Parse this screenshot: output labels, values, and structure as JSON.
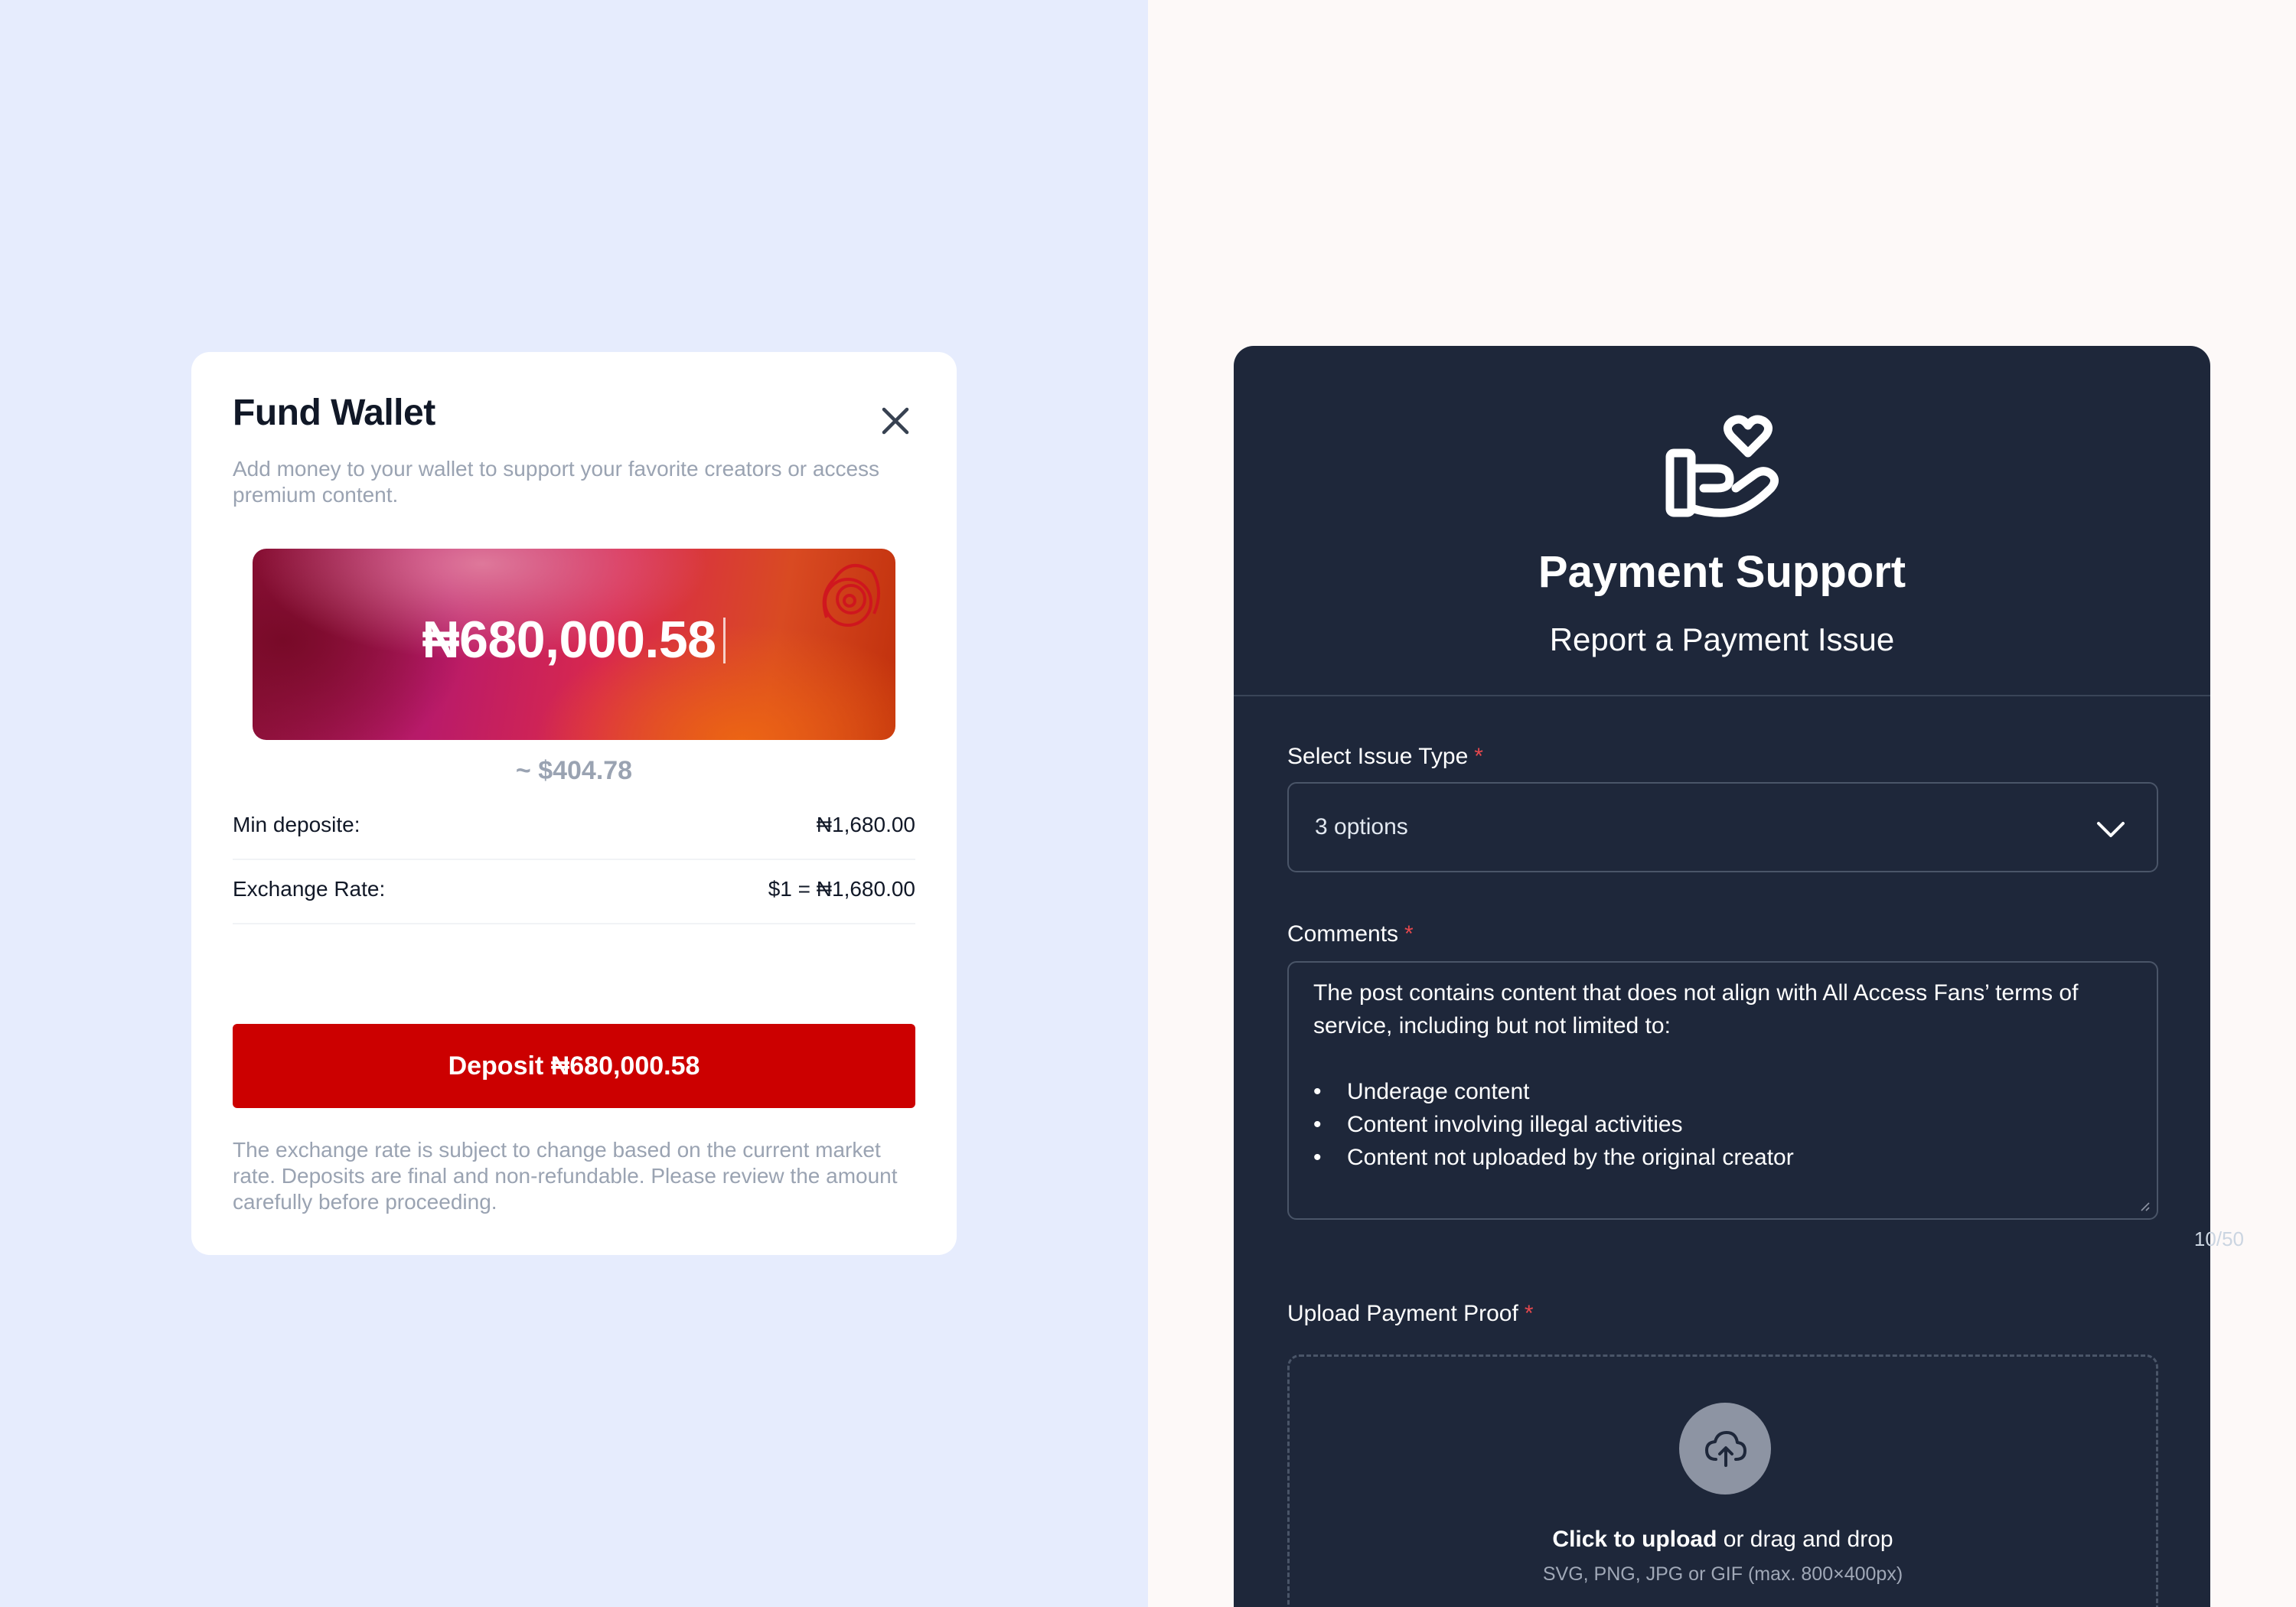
{
  "wallet": {
    "title": "Fund Wallet",
    "subtitle": "Add money to your wallet to support your favorite creators or access premium content.",
    "amount": "₦680,000.58",
    "usd_equivalent": "~ $404.78",
    "min_deposit_label": "Min deposite:",
    "min_deposit_value": "₦1,680.00",
    "exchange_rate_label": "Exchange Rate:",
    "exchange_rate_value": "$1 = ₦1,680.00",
    "deposit_button_label": "Deposit ₦680,000.58",
    "note": "The exchange rate is subject to change based on the current market rate. Deposits are final and non-refundable. Please review the amount carefully before proceeding.",
    "accent_color": "#cc0000"
  },
  "support": {
    "title": "Payment Support",
    "subtitle": "Report a Payment Issue",
    "issue_type_label": "Select Issue Type",
    "issue_type_value": "3 options",
    "comments_label": "Comments",
    "comments_intro": "The post contains content that does not align with All Access Fans’ terms of service, including but not limited to:",
    "comments_items": [
      "Underage content",
      "Content involving illegal activities",
      "Content not uploaded by the original creator"
    ],
    "char_count": "10/50",
    "upload_label": "Upload Payment Proof",
    "upload_cta": "Click to upload",
    "upload_cta_rest": " or drag and drop",
    "upload_hint": "SVG, PNG, JPG or GIF (max. 800×400px)",
    "required_marker": "*",
    "icons": {
      "header": "hand-heart-icon",
      "select": "chevron-down-icon",
      "upload": "cloud-upload-icon",
      "close": "close-icon"
    },
    "card_color": "#1e273a"
  }
}
